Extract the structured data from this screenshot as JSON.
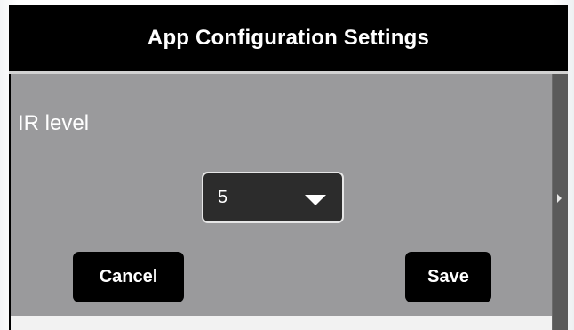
{
  "dialog": {
    "title": "App Configuration Settings"
  },
  "form": {
    "ir_level_label": "IR level",
    "ir_level_value": "5"
  },
  "buttons": {
    "cancel_label": "Cancel",
    "save_label": "Save"
  },
  "colors": {
    "header_bg": "#000000",
    "content_bg": "#9a9a9c",
    "select_bg": "#2c2c2c",
    "button_bg": "#000000",
    "text": "#ffffff"
  },
  "icons": {
    "select_caret": "chevron-down-icon",
    "scroll_arrow": "arrow-right-icon"
  }
}
